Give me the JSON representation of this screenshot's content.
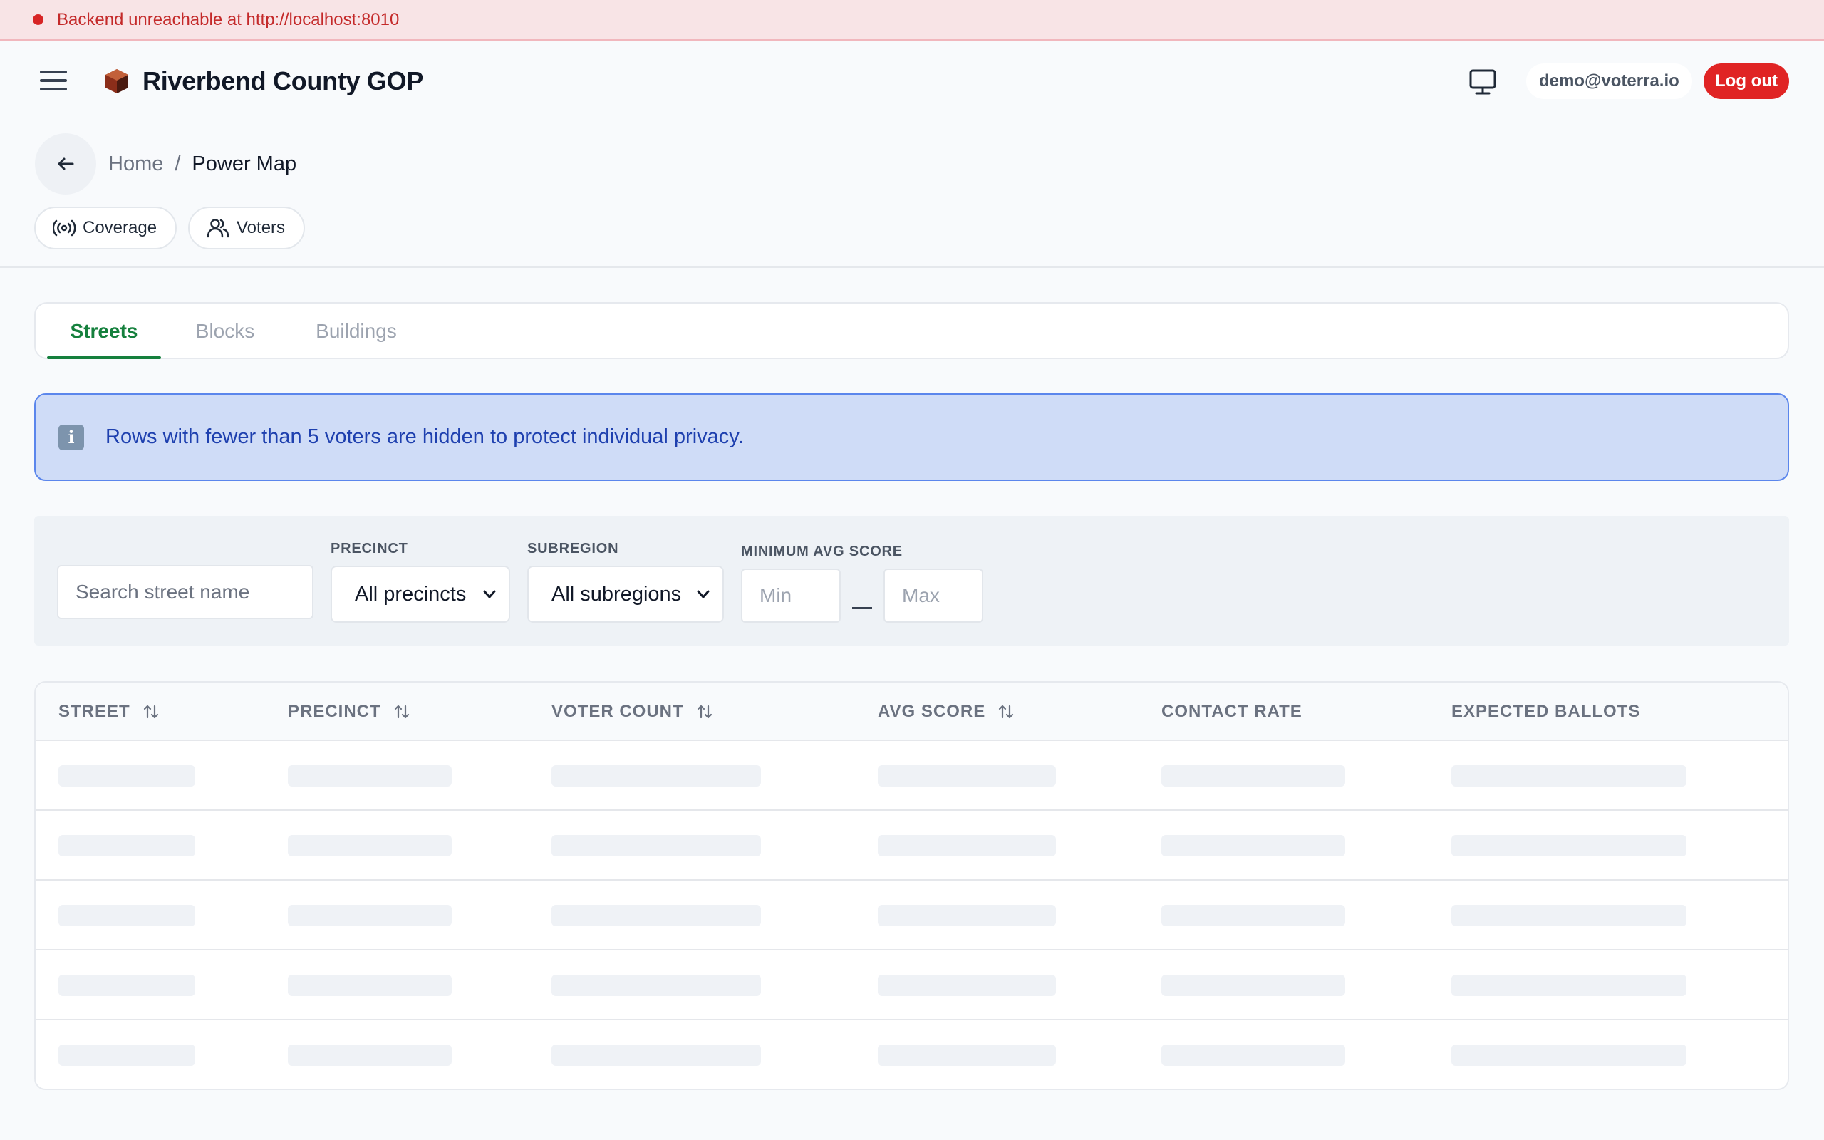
{
  "error_banner": {
    "text": "Backend unreachable at http://localhost:8010"
  },
  "header": {
    "org_name": "Riverbend County GOP",
    "user_email": "demo@voterra.io",
    "logout_label": "Log out"
  },
  "breadcrumb": {
    "home": "Home",
    "separator": "/",
    "current": "Power Map"
  },
  "chips": {
    "coverage": "Coverage",
    "voters": "Voters"
  },
  "tabs": [
    {
      "label": "Streets",
      "active": true
    },
    {
      "label": "Blocks",
      "active": false
    },
    {
      "label": "Buildings",
      "active": false
    }
  ],
  "info_banner": {
    "text": "Rows with fewer than 5 voters are hidden to protect individual privacy."
  },
  "filters": {
    "search_placeholder": "Search street name",
    "precinct_label": "PRECINCT",
    "precinct_value": "All precincts",
    "subregion_label": "SUBREGION",
    "subregion_value": "All subregions",
    "score_label": "MINIMUM AVG SCORE",
    "min_placeholder": "Min",
    "max_placeholder": "Max"
  },
  "table": {
    "columns": [
      "STREET",
      "PRECINCT",
      "VOTER COUNT",
      "AVG SCORE",
      "CONTACT RATE",
      "EXPECTED BALLOTS"
    ],
    "loading_rows": 5
  },
  "colors": {
    "accent_green": "#15803d",
    "danger_red": "#e02424",
    "info_blue": "#1e40af"
  },
  "icons": [
    "menu-icon",
    "logo-cube-icon",
    "monitor-icon",
    "arrow-left-icon",
    "broadcast-icon",
    "users-icon",
    "info-icon",
    "chevron-down-icon",
    "sort-icon"
  ]
}
